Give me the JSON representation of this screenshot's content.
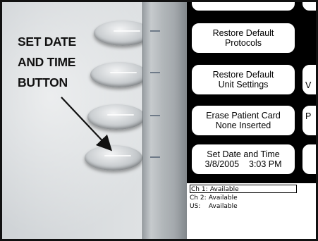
{
  "annotation": {
    "lines": [
      "SET DATE",
      "AND TIME",
      "BUTTON"
    ]
  },
  "screen_menu": {
    "restore_protocols": [
      "Restore Default",
      "Protocols"
    ],
    "restore_settings": [
      "Restore Default",
      "Unit Settings"
    ],
    "erase_card": [
      "Erase Patient Card",
      "None Inserted"
    ],
    "set_date": [
      "Set Date and Time",
      "3/8/2005    3:03 PM"
    ]
  },
  "side_menu": {
    "v_label": "V",
    "p_label": "P"
  },
  "status": [
    {
      "label": "Ch 1:",
      "value": "Available"
    },
    {
      "label": "Ch 2:",
      "value": "Available"
    },
    {
      "label": "US:",
      "value": "Available"
    }
  ],
  "colors": {
    "arrow": "#111111",
    "screen_background": "#000000"
  }
}
